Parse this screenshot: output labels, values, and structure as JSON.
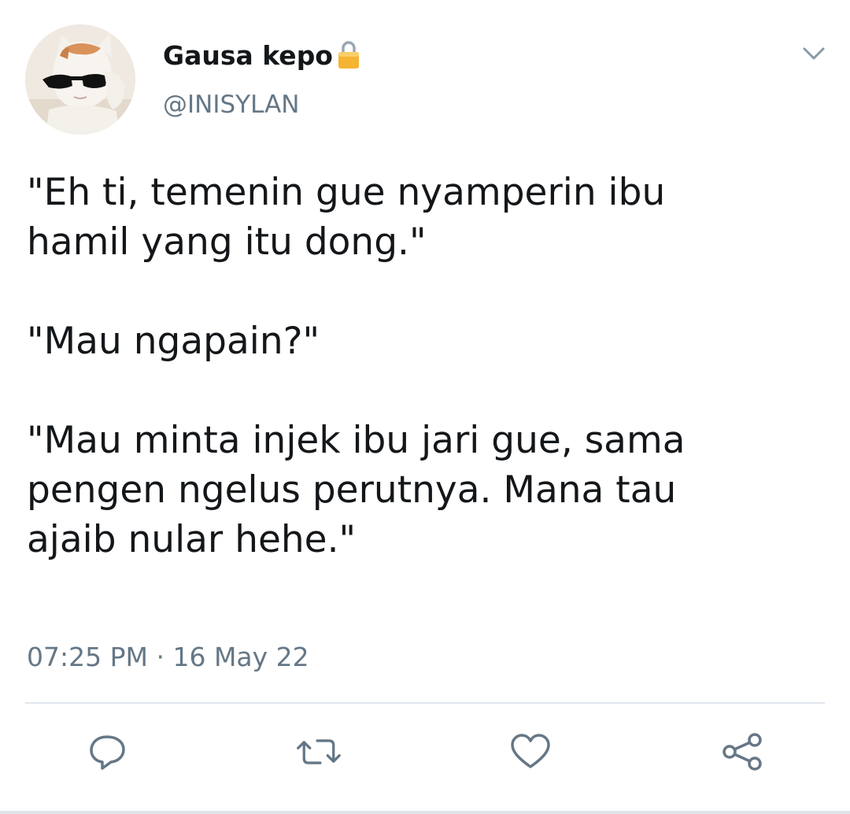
{
  "tweet": {
    "display_name": "Gausa kepo",
    "handle": "@INISYLAN",
    "paragraphs": [
      "\"Eh ti, temenin gue nyamperin ibu\nhamil yang itu dong.\"",
      "\"Mau ngapain?\"",
      "\"Mau minta injek ibu jari gue, sama\npengen ngelus perutnya. Mana tau\najaib nular hehe.\""
    ],
    "time": "07:25 PM",
    "separator": "·",
    "date": "16 May 22"
  },
  "icons": {
    "protected": "lock-icon",
    "menu": "chevron-down-icon",
    "reply": "reply-icon",
    "retweet": "retweet-icon",
    "like": "heart-icon",
    "share": "share-icon"
  },
  "colors": {
    "text": "#14171a",
    "secondary": "#657786",
    "divider": "#e1e8ed",
    "lock": "#f5b431"
  }
}
